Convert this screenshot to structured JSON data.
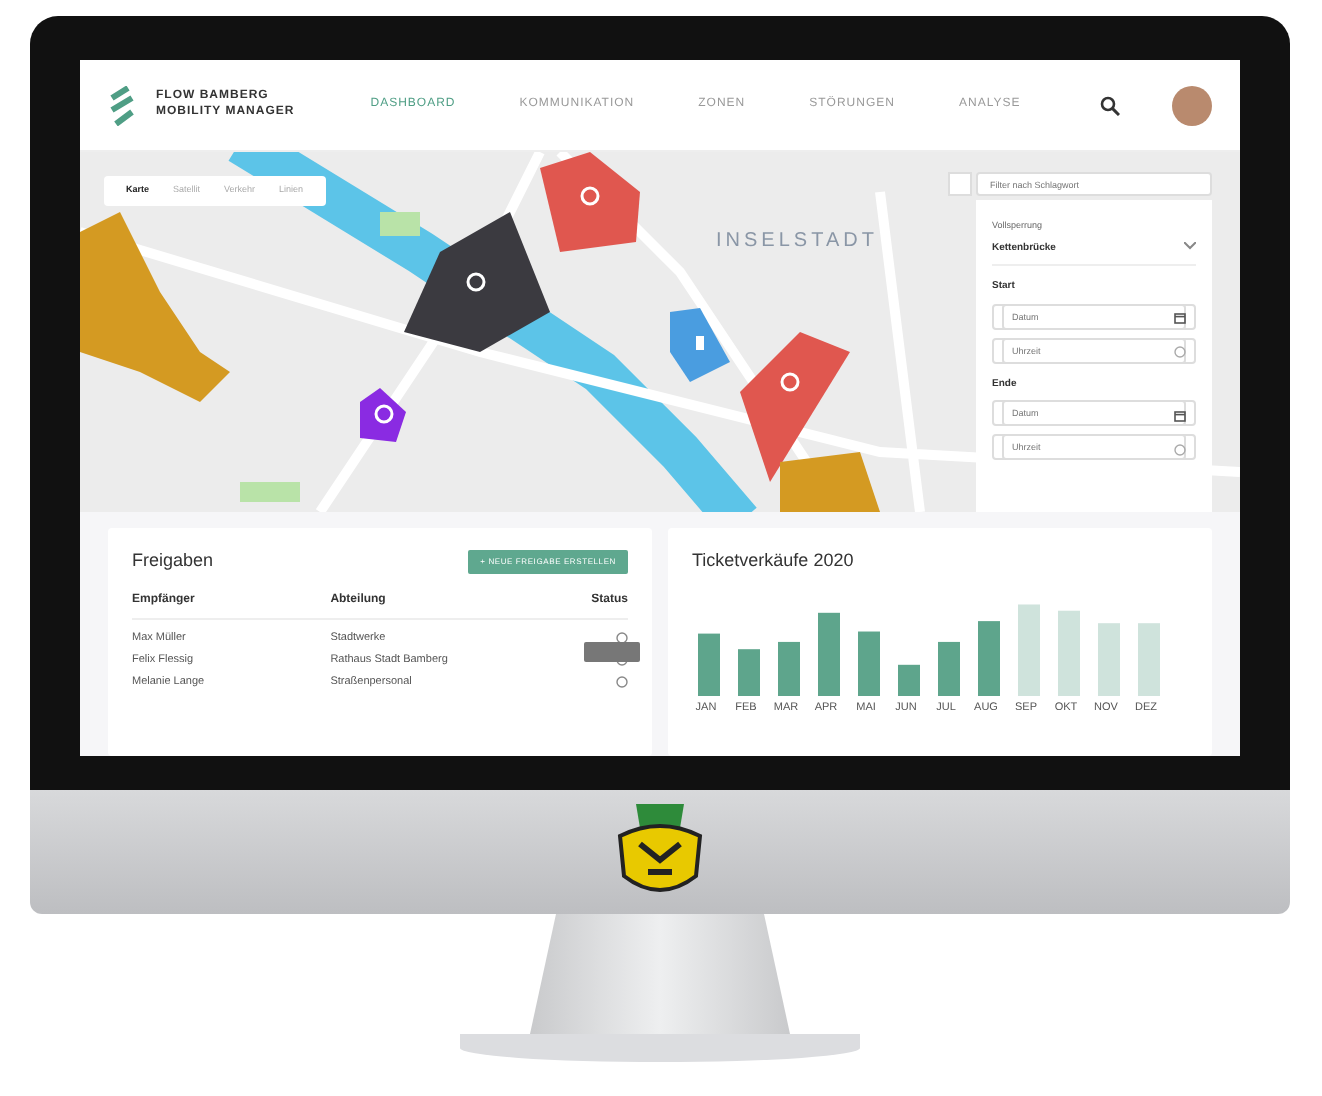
{
  "app": {
    "logo_line_1": "FLOW BAMBERG",
    "logo_line_2": "MOBILITY MANAGER"
  },
  "nav": [
    {
      "label": "DASHBOARD",
      "selected": true
    },
    {
      "label": "KOMMUNIKATION",
      "selected": false
    },
    {
      "label": "ZONEN",
      "selected": false
    },
    {
      "label": "STÖRUNGEN",
      "selected": false
    },
    {
      "label": "ANALYSE",
      "selected": false
    }
  ],
  "map": {
    "district_label": "INSELSTADT",
    "tabs": [
      {
        "label": "Karte",
        "selected": true
      },
      {
        "label": "Satellit",
        "selected": false
      },
      {
        "label": "Verkehr",
        "selected": false
      },
      {
        "label": "Linien",
        "selected": false
      }
    ],
    "zones": [
      {
        "kind": "restricted",
        "color": "#3b3a40"
      },
      {
        "kind": "restricted",
        "color": "#e0574f"
      },
      {
        "kind": "restricted",
        "color": "#e0574f"
      },
      {
        "kind": "parking",
        "color": "#4a9de0"
      },
      {
        "kind": "event",
        "color": "#8a2be2"
      },
      {
        "kind": "area",
        "color": "#d49a22"
      },
      {
        "kind": "area",
        "color": "#d49a22"
      }
    ]
  },
  "filter_panel": {
    "search": {
      "placeholder": "Filter nach Schlagwort"
    },
    "select": {
      "label": "Vollsperrung",
      "value": "Kettenbrücke"
    },
    "sections": [
      {
        "title": "Start",
        "fields": [
          {
            "placeholder": "Datum",
            "kind": "date"
          },
          {
            "placeholder": "Uhrzeit",
            "kind": "time"
          }
        ]
      },
      {
        "title": "Ende",
        "fields": [
          {
            "placeholder": "Datum",
            "kind": "date"
          },
          {
            "placeholder": "Uhrzeit",
            "kind": "time"
          }
        ]
      }
    ]
  },
  "approvals": {
    "title": "Freigaben",
    "button": "+ NEUE FREIGABE ERSTELLEN",
    "columns": [
      "Empfänger",
      "Abteilung",
      "Status"
    ],
    "rows": [
      {
        "cells": [
          "Max Müller",
          "Stadtwerke"
        ],
        "tooltip": false
      },
      {
        "cells": [
          "Felix Flessig",
          "Rathaus Stadt Bamberg"
        ],
        "tooltip": true
      },
      {
        "cells": [
          "Melanie Lange",
          "Straßenpersonal"
        ],
        "tooltip": false
      }
    ]
  },
  "ticket_sales": {
    "title": "Ticketverkäufe 2020",
    "months": [
      {
        "label": "JAN",
        "projected": false
      },
      {
        "label": "FEB",
        "projected": false
      },
      {
        "label": "MAR",
        "projected": false
      },
      {
        "label": "APR",
        "projected": false
      },
      {
        "label": "MAI",
        "projected": false
      },
      {
        "label": "JUN",
        "projected": false
      },
      {
        "label": "JUL",
        "projected": false
      },
      {
        "label": "AUG",
        "projected": false
      },
      {
        "label": "SEP",
        "projected": true
      },
      {
        "label": "OKT",
        "projected": true
      },
      {
        "label": "NOV",
        "projected": true
      },
      {
        "label": "DEZ",
        "projected": true
      }
    ]
  }
}
